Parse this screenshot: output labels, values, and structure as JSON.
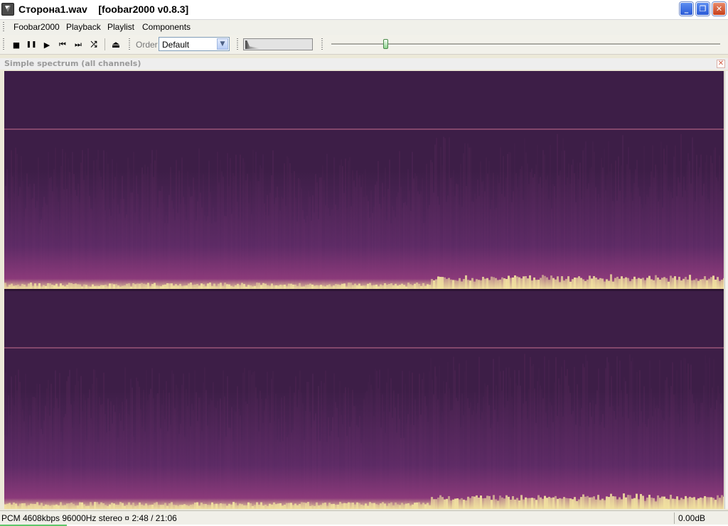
{
  "window": {
    "title": "Сторона1.wav    [foobar2000 v0.8.3]",
    "minimize_glyph": "_",
    "maximize_glyph": "❐",
    "close_glyph": "✕"
  },
  "menu": {
    "items": [
      "Foobar2000",
      "Playback",
      "Playlist",
      "Components"
    ]
  },
  "toolbar": {
    "buttons": [
      {
        "name": "stop",
        "icon": "stop-icon",
        "glyph": "■"
      },
      {
        "name": "pause",
        "icon": "pause-icon",
        "glyph": "❚❚"
      },
      {
        "name": "play",
        "icon": "play-icon",
        "glyph": "▶"
      },
      {
        "name": "previous",
        "icon": "previous-icon",
        "glyph": "⏮"
      },
      {
        "name": "next",
        "icon": "next-icon",
        "glyph": "⏭"
      },
      {
        "name": "random",
        "icon": "random-icon",
        "glyph": "⤮"
      },
      {
        "name": "eject",
        "icon": "eject-icon",
        "glyph": "⏏"
      }
    ],
    "order_label": "Order",
    "order_value": "Default",
    "seek_position_fraction": 0.139
  },
  "panel": {
    "title": "Simple spectrum (all channels)",
    "close_glyph": "✕",
    "colors": {
      "background": "#3d1e47",
      "mid": "#8b3a7a",
      "hot": "#f2e3a0"
    }
  },
  "status": {
    "info": "PCM 4608kbps 96000Hz stereo  ¤ 2:48 / 21:06",
    "volume": "0.00dB"
  }
}
